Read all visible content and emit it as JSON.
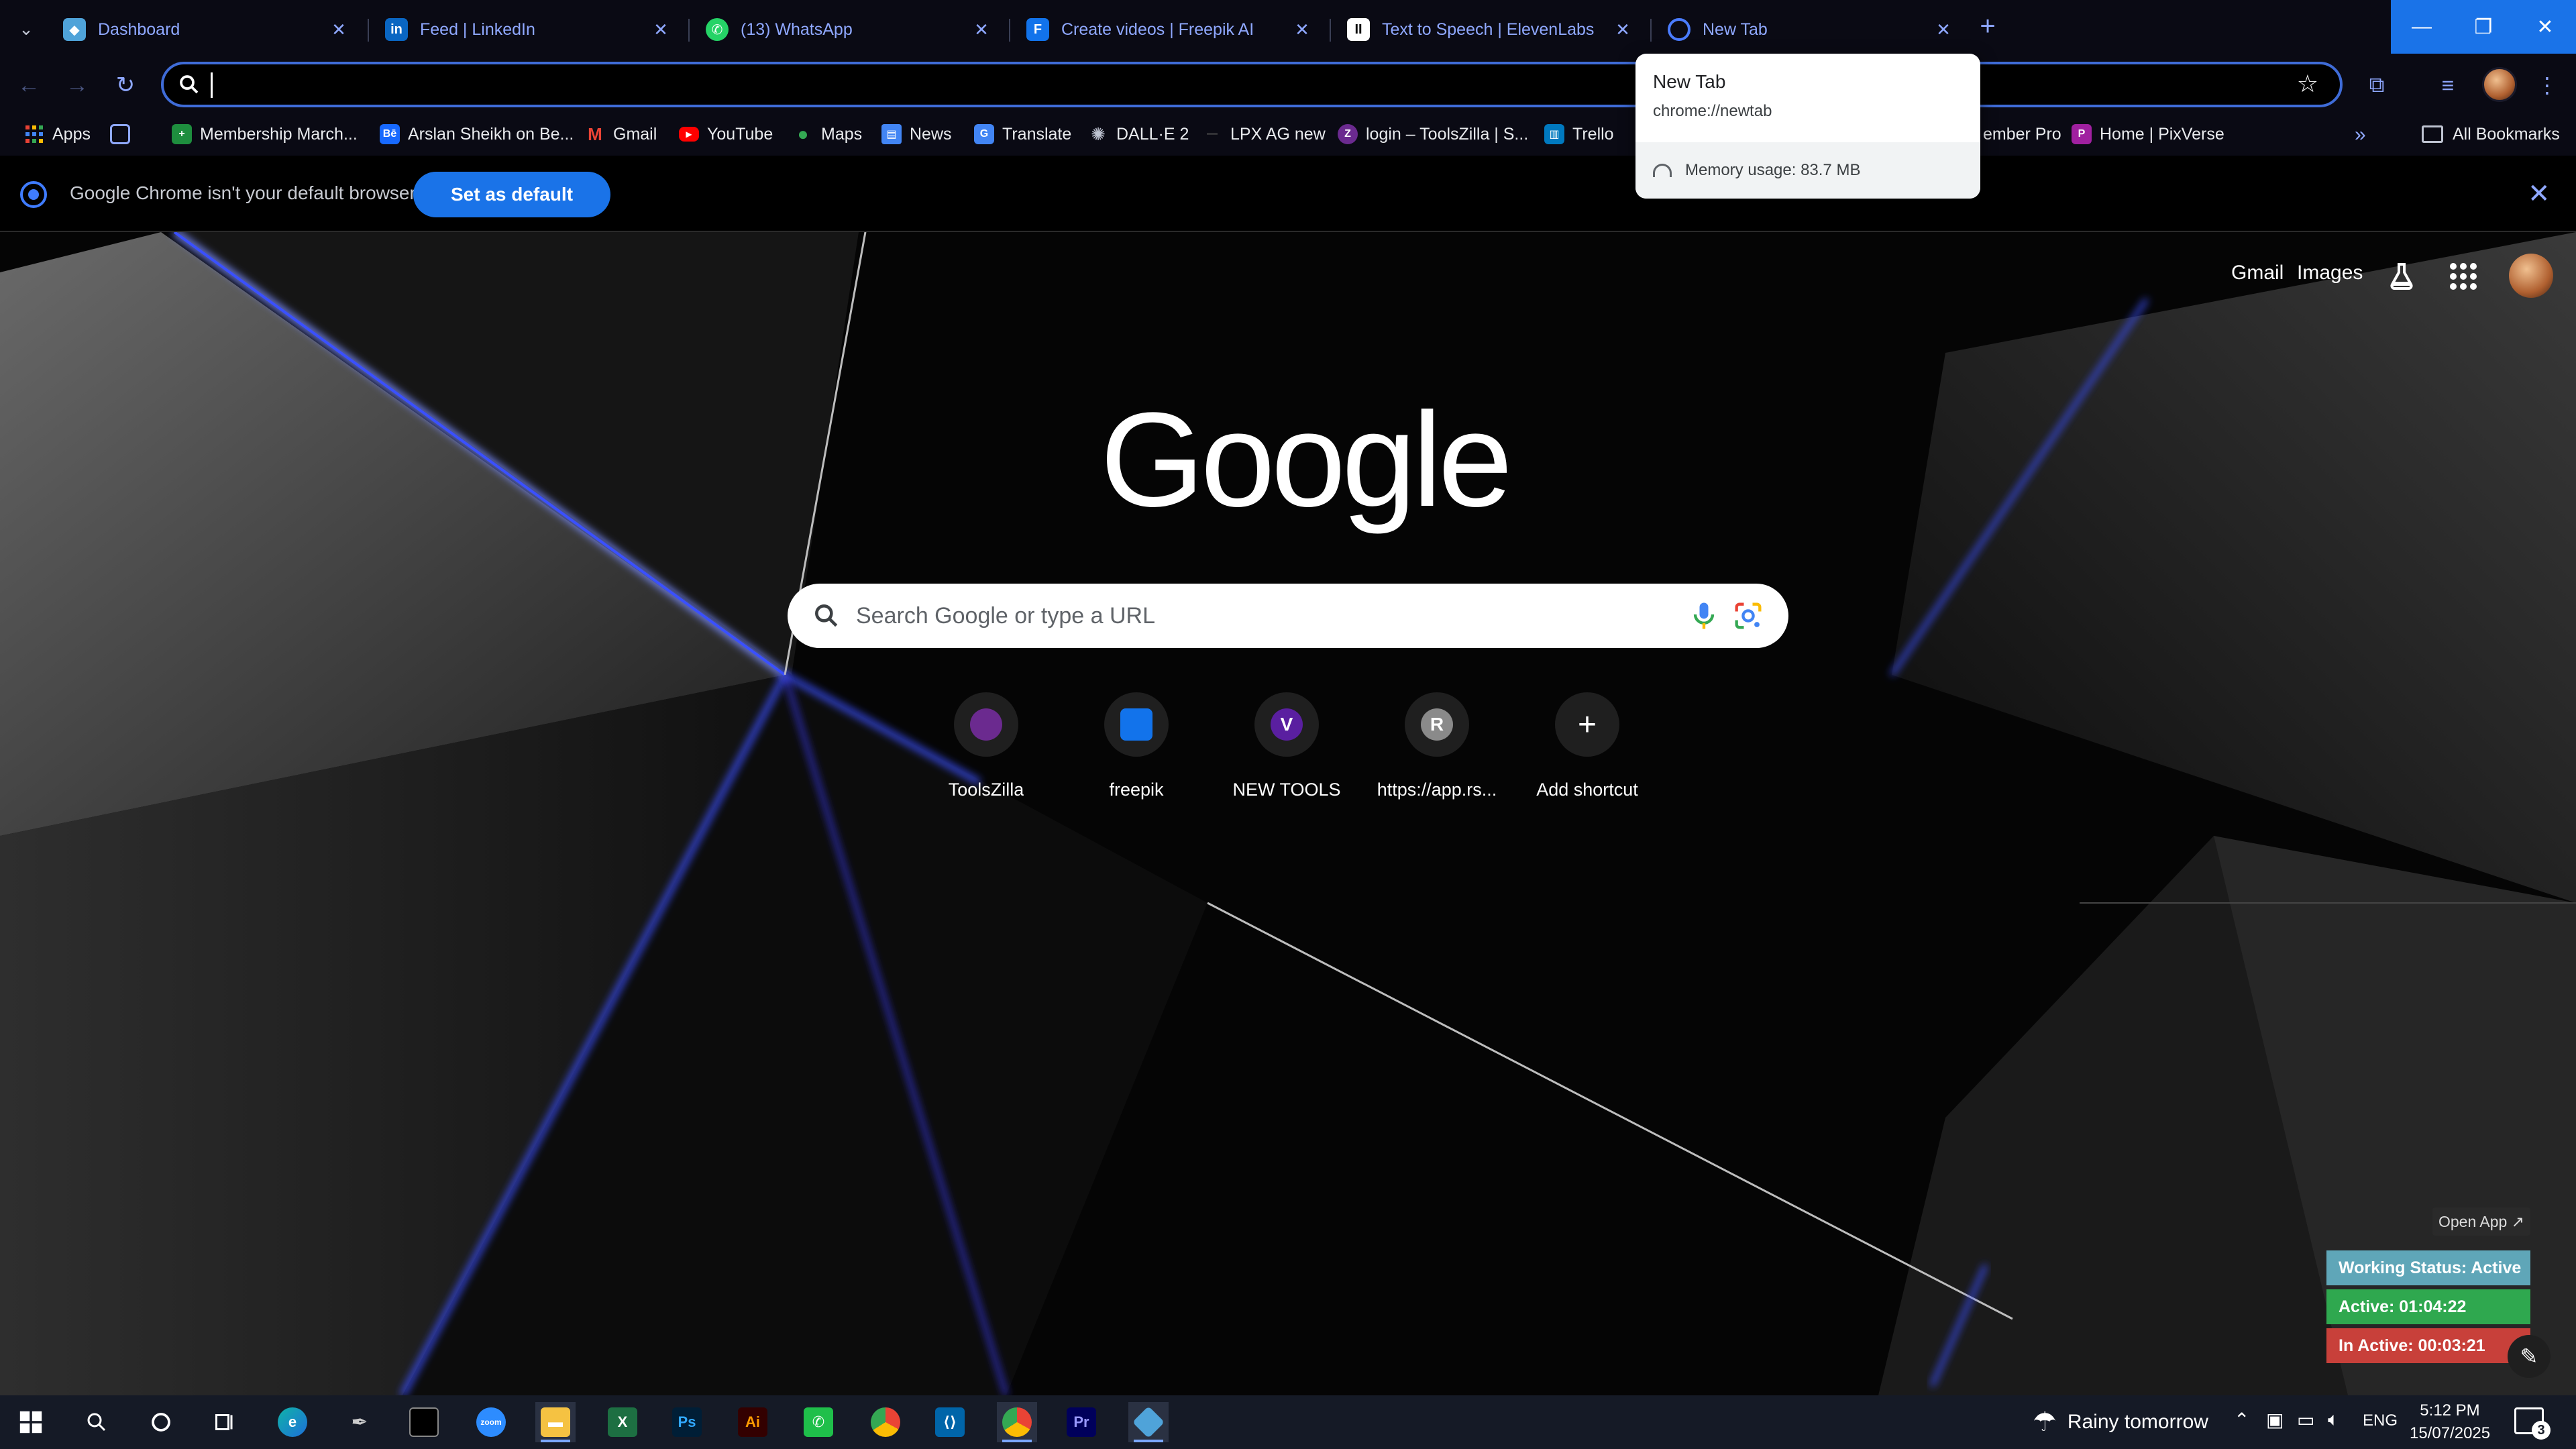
{
  "tabs": [
    {
      "title": "Dashboard",
      "icon": "dashboard-favicon",
      "color": "#4fa3d9"
    },
    {
      "title": "Feed | LinkedIn",
      "icon": "linkedin-favicon",
      "color": "#0a66c2"
    },
    {
      "title": "(13) WhatsApp",
      "icon": "whatsapp-favicon",
      "color": "#25d366"
    },
    {
      "title": "Create videos | Freepik AI",
      "icon": "freepik-favicon",
      "color": "#1273eb"
    },
    {
      "title": "Text to Speech | ElevenLabs",
      "icon": "elevenlabs-favicon",
      "color": "#ffffff"
    },
    {
      "title": "New Tab",
      "icon": "chrome-favicon",
      "color": "#4a7cff"
    }
  ],
  "hovercard": {
    "title": "New Tab",
    "url": "chrome://newtab",
    "memory": "Memory usage: 83.7 MB"
  },
  "bookmarks": [
    {
      "label": "Apps",
      "icon": "apps-grid-icon"
    },
    {
      "label": "",
      "icon": "tab-groups-icon"
    },
    {
      "label": "Membership March...",
      "icon": "membership-icon"
    },
    {
      "label": "Arslan Sheikh on Be...",
      "icon": "behance-icon"
    },
    {
      "label": "Gmail",
      "icon": "gmail-icon"
    },
    {
      "label": "YouTube",
      "icon": "youtube-icon"
    },
    {
      "label": "Maps",
      "icon": "maps-icon"
    },
    {
      "label": "News",
      "icon": "news-icon"
    },
    {
      "label": "Translate",
      "icon": "translate-icon"
    },
    {
      "label": "DALL·E 2",
      "icon": "openai-icon"
    },
    {
      "label": "LPX AG new",
      "icon": "lpx-icon"
    },
    {
      "label": "login – ToolsZilla | S...",
      "icon": "toolszilla-icon"
    },
    {
      "label": "Trello",
      "icon": "trello-icon"
    },
    {
      "label": "ember Pro",
      "icon": ""
    },
    {
      "label": "Home | PixVerse",
      "icon": "pixverse-icon"
    }
  ],
  "bookmarks_all": "All Bookmarks",
  "infobar": {
    "message": "Google Chrome isn't your default browser",
    "button": "Set as default"
  },
  "ntp": {
    "links": {
      "gmail": "Gmail",
      "images": "Images"
    },
    "logo": "Google",
    "search_placeholder": "Search Google or type a URL",
    "shortcuts": [
      {
        "label": "ToolsZilla",
        "initial": "",
        "color": "#6b2a8f"
      },
      {
        "label": "freepik",
        "initial": "",
        "color": "#1273eb"
      },
      {
        "label": "NEW TOOLS",
        "initial": "V",
        "color": "#5a1fa0"
      },
      {
        "label": "https://app.rs...",
        "initial": "R",
        "color": "#8a8a8a"
      },
      {
        "label": "Add shortcut",
        "initial": "+",
        "color": "#1f1f1f"
      }
    ]
  },
  "tracker": {
    "open_app": "Open App ↗",
    "status": "Working Status: Active",
    "active": "Active: 01:04:22",
    "inactive": "In Active: 00:03:21",
    "colors": {
      "status": "#5fa6b8",
      "active": "#2fa84f",
      "inactive": "#c8403a"
    }
  },
  "taskbar": {
    "weather": "Rainy tomorrow",
    "language": "ENG",
    "time": "5:12 PM",
    "date": "15/07/2025",
    "notifications": "3"
  }
}
